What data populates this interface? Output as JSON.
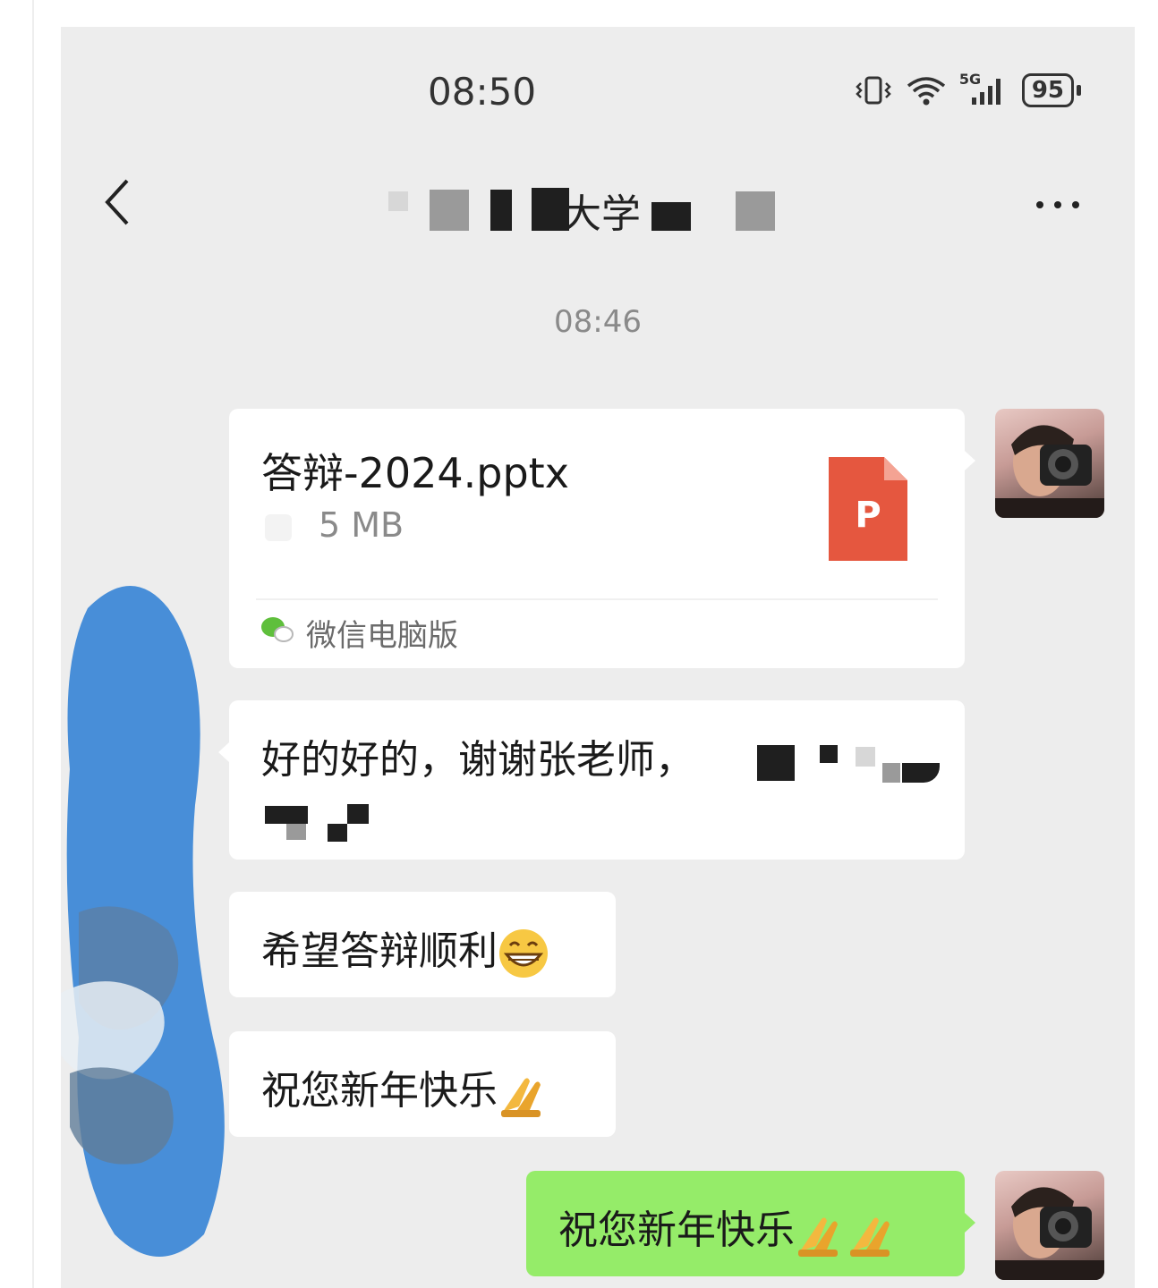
{
  "status_bar": {
    "time": "08:50",
    "network": "5G",
    "battery": "95"
  },
  "nav": {
    "title": "大学",
    "back_icon": "chevron-left-icon",
    "more_icon": "more-dots-icon"
  },
  "chat": {
    "timestamp": "08:46",
    "file": {
      "name": "答辩-2024.pptx",
      "size": "5 MB",
      "icon_letter": "P",
      "source": "微信电脑版"
    },
    "messages": [
      {
        "side": "left",
        "text": "好的好的，谢谢张老师，"
      },
      {
        "side": "left",
        "text": "希望答辩顺利",
        "emoji": "grin-emoji"
      },
      {
        "side": "left",
        "text": "祝您新年快乐",
        "emoji": "pray-emoji"
      },
      {
        "side": "right",
        "text": "祝您新年快乐",
        "emoji": "pray-emoji-x2"
      }
    ]
  },
  "colors": {
    "chat_background": "#ededed",
    "outgoing_bubble": "#95ec69",
    "incoming_bubble": "#ffffff",
    "ppt_icon": "#e5573f",
    "scribble": "#3a86d6"
  }
}
